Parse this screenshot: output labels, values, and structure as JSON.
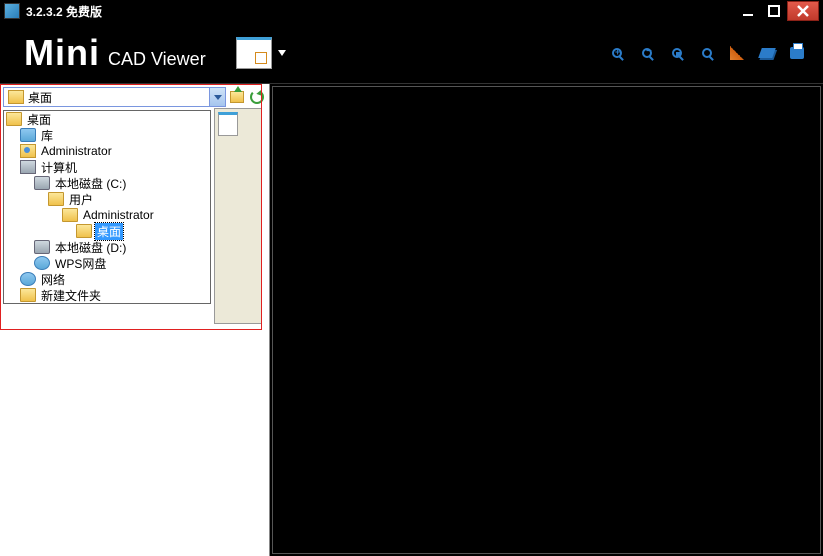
{
  "title": "3.2.3.2 免费版",
  "logo": {
    "main": "Mini",
    "sub": "CAD Viewer"
  },
  "combo": {
    "value": "桌面"
  },
  "tree": {
    "n0": {
      "indent": 0,
      "icon": "folder",
      "label": "桌面"
    },
    "n1": {
      "indent": 14,
      "icon": "lib",
      "label": "库"
    },
    "n2": {
      "indent": 14,
      "icon": "user",
      "label": "Administrator"
    },
    "n3": {
      "indent": 14,
      "icon": "comp",
      "label": "计算机"
    },
    "n4": {
      "indent": 28,
      "icon": "drive",
      "label": "本地磁盘 (C:)"
    },
    "n5": {
      "indent": 42,
      "icon": "folder",
      "label": "用户"
    },
    "n6": {
      "indent": 56,
      "icon": "folder",
      "label": "Administrator"
    },
    "n7": {
      "indent": 70,
      "icon": "folder",
      "label": "桌面"
    },
    "n8": {
      "indent": 28,
      "icon": "drive",
      "label": "本地磁盘 (D:)"
    },
    "n9": {
      "indent": 28,
      "icon": "net",
      "label": "WPS网盘"
    },
    "n10": {
      "indent": 14,
      "icon": "net",
      "label": "网络"
    },
    "n11": {
      "indent": 14,
      "icon": "folder",
      "label": "新建文件夹"
    }
  }
}
